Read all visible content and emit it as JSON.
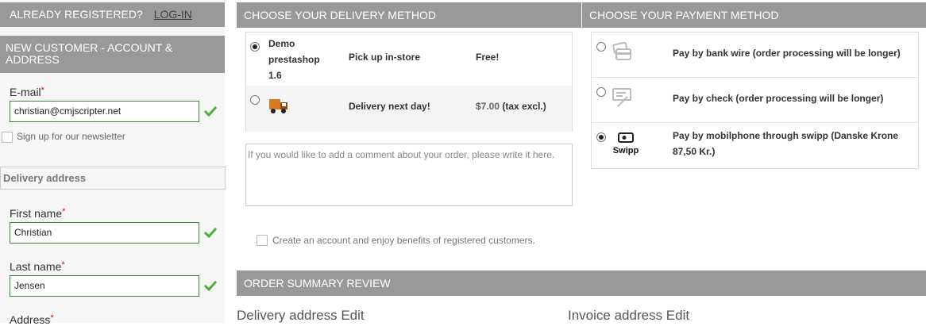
{
  "login": {
    "prompt": "ALREADY REGISTERED?",
    "link": "LOG-IN"
  },
  "new_customer": {
    "title": "NEW CUSTOMER - ACCOUNT & ADDRESS"
  },
  "email": {
    "label": "E-mail",
    "required": "*",
    "value": "christian@cmjscripter.net"
  },
  "newsletter": {
    "label": "Sign up for our newsletter"
  },
  "delivery_address_section": "Delivery address",
  "first_name": {
    "label": "First name",
    "required": "*",
    "value": "Christian"
  },
  "last_name": {
    "label": "Last name",
    "required": "*",
    "value": "Jensen"
  },
  "address": {
    "label": "Address",
    "required": "*"
  },
  "delivery": {
    "title": "CHOOSE YOUR DELIVERY METHOD",
    "carriers": [
      {
        "name_lines": [
          "Demo",
          "prestashop",
          "1.6"
        ],
        "desc": "Pick up in-store",
        "price": "Free!",
        "selected": true
      },
      {
        "desc": "Delivery next day!",
        "price_amount": "$7.00",
        "price_suffix": "(tax excl.)",
        "selected": false
      }
    ],
    "comment_placeholder": "If you would like to add a comment about your order, please write it here.",
    "create_account": "Create an account and enjoy benefits of registered customers."
  },
  "payment": {
    "title": "CHOOSE YOUR PAYMENT METHOD",
    "methods": [
      {
        "label": "Pay by bank wire (order processing will be longer)",
        "icon": "bank-card-icon",
        "selected": false
      },
      {
        "label": "Pay by check (order processing will be longer)",
        "icon": "check-icon",
        "selected": false
      },
      {
        "label": "Pay by mobilphone through swipp (Danske Krone 87,50 Kr.)",
        "icon": "swipp-logo",
        "logo_text": "Swipp",
        "selected": true
      }
    ]
  },
  "summary": {
    "title": "ORDER SUMMARY REVIEW",
    "delivery_address": "Delivery address Edit",
    "invoice_address": "Invoice address Edit"
  },
  "colors": {
    "bar": "#999999",
    "valid": "#3a8a3a",
    "required": "#ee0000"
  }
}
